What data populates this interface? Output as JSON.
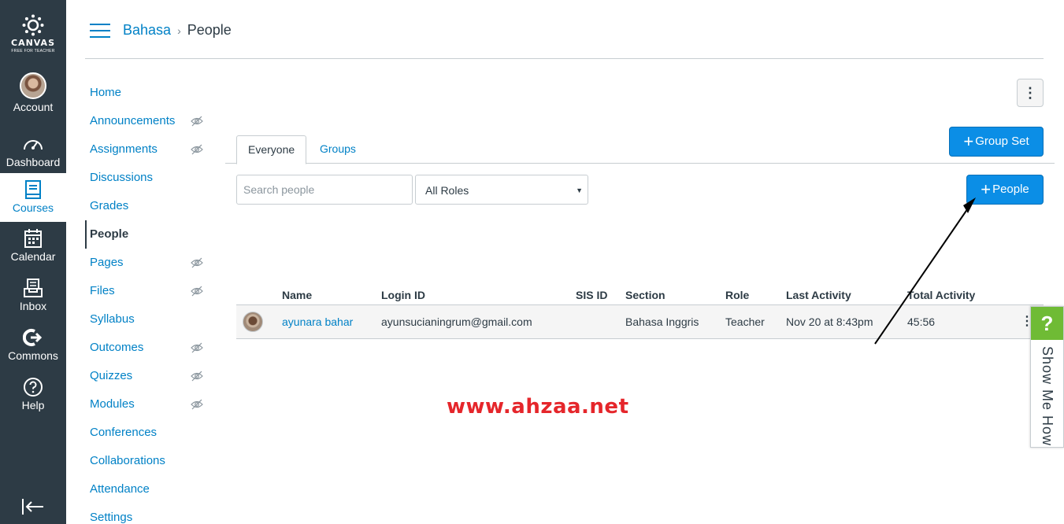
{
  "global_nav": {
    "logo": {
      "word": "CANVAS",
      "tag": "FREE FOR TEACHER"
    },
    "items": [
      {
        "label": "Account",
        "icon": "avatar"
      },
      {
        "label": "Dashboard",
        "icon": "dashboard-icon"
      },
      {
        "label": "Courses",
        "icon": "book-icon"
      },
      {
        "label": "Calendar",
        "icon": "calendar-icon"
      },
      {
        "label": "Inbox",
        "icon": "inbox-icon"
      },
      {
        "label": "Commons",
        "icon": "commons-icon"
      },
      {
        "label": "Help",
        "icon": "help-icon"
      }
    ],
    "collapse_icon": "collapse-nav-icon",
    "active_color": "#0081c6",
    "background": "#2d3b45"
  },
  "header": {
    "breadcrumb": {
      "course": "Bahasa",
      "separator": "›",
      "current": "People"
    }
  },
  "course_nav": {
    "items": [
      {
        "label": "Home",
        "hidden": false
      },
      {
        "label": "Announcements",
        "hidden": true
      },
      {
        "label": "Assignments",
        "hidden": true
      },
      {
        "label": "Discussions",
        "hidden": false
      },
      {
        "label": "Grades",
        "hidden": false
      },
      {
        "label": "People",
        "hidden": false,
        "active": true
      },
      {
        "label": "Pages",
        "hidden": true
      },
      {
        "label": "Files",
        "hidden": true
      },
      {
        "label": "Syllabus",
        "hidden": false
      },
      {
        "label": "Outcomes",
        "hidden": true
      },
      {
        "label": "Quizzes",
        "hidden": true
      },
      {
        "label": "Modules",
        "hidden": true
      },
      {
        "label": "Conferences",
        "hidden": false
      },
      {
        "label": "Collaborations",
        "hidden": false
      },
      {
        "label": "Attendance",
        "hidden": false
      },
      {
        "label": "Settings",
        "hidden": false
      }
    ]
  },
  "toolbar": {
    "more_options": "⋮",
    "group_set_label": "Group Set",
    "add_people_label": "People",
    "plus": "+"
  },
  "tabs": [
    {
      "label": "Everyone",
      "active": true
    },
    {
      "label": "Groups",
      "active": false
    }
  ],
  "filters": {
    "search_placeholder": "Search people",
    "role_selected": "All Roles",
    "caret": "▼"
  },
  "roster": {
    "columns": [
      "Name",
      "Login ID",
      "SIS ID",
      "Section",
      "Role",
      "Last Activity",
      "Total Activity"
    ],
    "rows": [
      {
        "name": "ayunara bahar",
        "login_id": "ayunsucianingrum@gmail.com",
        "sis_id": "",
        "section": "Bahasa Inggris",
        "role": "Teacher",
        "last_activity": "Nov 20 at 8:43pm",
        "total_activity": "45:56",
        "kebab": "⋮"
      }
    ]
  },
  "watermark": "www.ahzaa.net",
  "show_me_how": {
    "icon": "?",
    "label": "Show Me How",
    "color": "#6fbb35"
  }
}
